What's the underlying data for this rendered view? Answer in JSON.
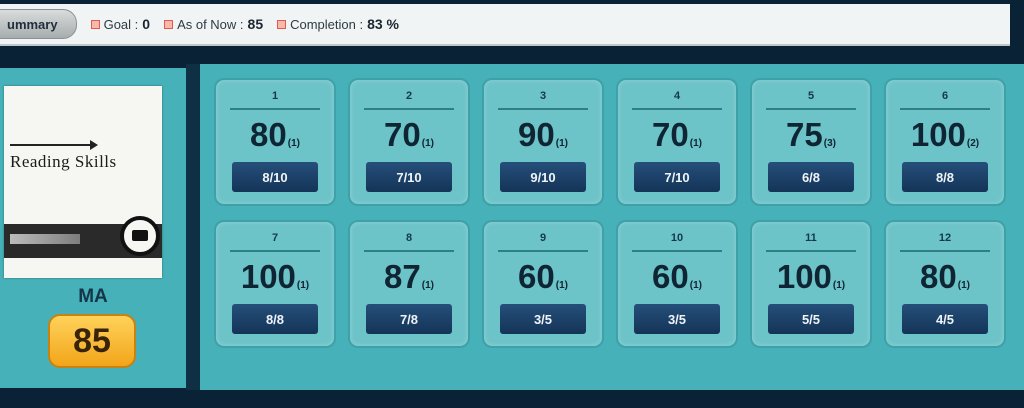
{
  "topbar": {
    "tab_label": "ummary",
    "stats": [
      {
        "label": "Goal :",
        "value": "0"
      },
      {
        "label": "As of Now :",
        "value": "85"
      },
      {
        "label": "Completion :",
        "value": "83 %"
      }
    ]
  },
  "left": {
    "book_title": "Reading Skills",
    "subject": "MA",
    "score": "85"
  },
  "cards": [
    {
      "num": "1",
      "score": "80",
      "attempts": "(1)",
      "fraction": "8/10"
    },
    {
      "num": "2",
      "score": "70",
      "attempts": "(1)",
      "fraction": "7/10"
    },
    {
      "num": "3",
      "score": "90",
      "attempts": "(1)",
      "fraction": "9/10"
    },
    {
      "num": "4",
      "score": "70",
      "attempts": "(1)",
      "fraction": "7/10"
    },
    {
      "num": "5",
      "score": "75",
      "attempts": "(3)",
      "fraction": "6/8"
    },
    {
      "num": "6",
      "score": "100",
      "attempts": "(2)",
      "fraction": "8/8"
    },
    {
      "num": "7",
      "score": "100",
      "attempts": "(1)",
      "fraction": "8/8"
    },
    {
      "num": "8",
      "score": "87",
      "attempts": "(1)",
      "fraction": "7/8"
    },
    {
      "num": "9",
      "score": "60",
      "attempts": "(1)",
      "fraction": "3/5"
    },
    {
      "num": "10",
      "score": "60",
      "attempts": "(1)",
      "fraction": "3/5"
    },
    {
      "num": "11",
      "score": "100",
      "attempts": "(1)",
      "fraction": "5/5"
    },
    {
      "num": "12",
      "score": "80",
      "attempts": "(1)",
      "fraction": "4/5"
    }
  ]
}
